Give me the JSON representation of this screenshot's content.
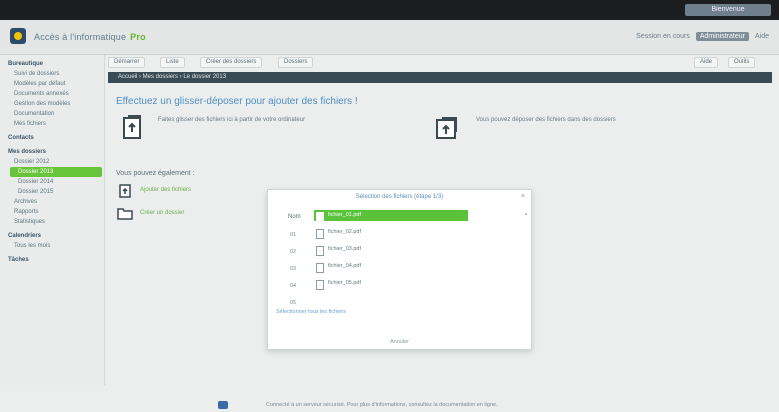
{
  "app": {
    "title": "Accès à l'informatique",
    "badge": "Pro",
    "user": "Session en cours",
    "account": "Administrateur",
    "lang": "Aide",
    "right_top": "Bienvenue"
  },
  "toolbar": {
    "items": [
      "Démarrer",
      "Liste",
      "Créer des dossiers",
      "Dossiers"
    ],
    "right_items": [
      "Aide",
      "Outils"
    ]
  },
  "breadcrumb": "Accueil  ›  Mes dossiers  ›  Le dossier 2013",
  "sidebar": {
    "items": [
      {
        "label": "Bureautique",
        "type": "head"
      },
      {
        "label": "Suivi de dossiers",
        "type": "sub"
      },
      {
        "label": "Modèles par défaut",
        "type": "sub"
      },
      {
        "label": "Documents annexés",
        "type": "sub"
      },
      {
        "label": "Gestion des modèles",
        "type": "sub"
      },
      {
        "label": "Documentation",
        "type": "sub"
      },
      {
        "label": "Mes fichiers",
        "type": "sub"
      },
      {
        "label": "Contacts",
        "type": "head"
      },
      {
        "label": "Mes dossiers",
        "type": "head"
      },
      {
        "label": "Dossier 2012",
        "type": "sub"
      },
      {
        "label": "Dossier 2013",
        "type": "active"
      },
      {
        "label": "Dossier 2014",
        "type": "sub2"
      },
      {
        "label": "Dossier 2015",
        "type": "sub2"
      },
      {
        "label": "Archives",
        "type": "sub"
      },
      {
        "label": "Rapports",
        "type": "sub"
      },
      {
        "label": "Statistiques",
        "type": "sub"
      },
      {
        "label": "Calendriers",
        "type": "head"
      },
      {
        "label": "Tous les mois",
        "type": "sub"
      },
      {
        "label": "Tâches",
        "type": "head"
      }
    ]
  },
  "main": {
    "headline": "Effectuez un glisser-déposer pour ajouter des fichiers !",
    "desc_left": "Faites glisser des fichiers ici à partir de votre ordinateur",
    "desc_right": "Vous pouvez déposer des fichiers dans des dossiers",
    "quick_title": "Vous pouvez également :",
    "quick_actions": [
      "Ajouter des fichiers",
      "Créer un dossier"
    ]
  },
  "dialog": {
    "title": "Sélection des fichiers (étape 1/3)",
    "close": "×",
    "column": "Nom",
    "rows": [
      {
        "label": "fichier_01.pdf",
        "selected": true
      },
      {
        "label": "fichier_02.pdf",
        "selected": false
      },
      {
        "label": "fichier_03.pdf",
        "selected": false
      },
      {
        "label": "fichier_04.pdf",
        "selected": false
      },
      {
        "label": "fichier_05.pdf",
        "selected": false
      }
    ],
    "row_labels": [
      "01",
      "02",
      "03",
      "04",
      "05"
    ],
    "link": "Sélectionner tous les fichiers",
    "footer": "Annuler"
  },
  "status": {
    "text": "Connecté à un serveur sécurisé. Pour plus d'informations, consultez la documentation en ligne."
  },
  "colors": {
    "accent": "#5bc33b",
    "topbar": "#1b1d1f",
    "breadcrumb": "#3b4b56",
    "headline": "#4d8fc4"
  }
}
